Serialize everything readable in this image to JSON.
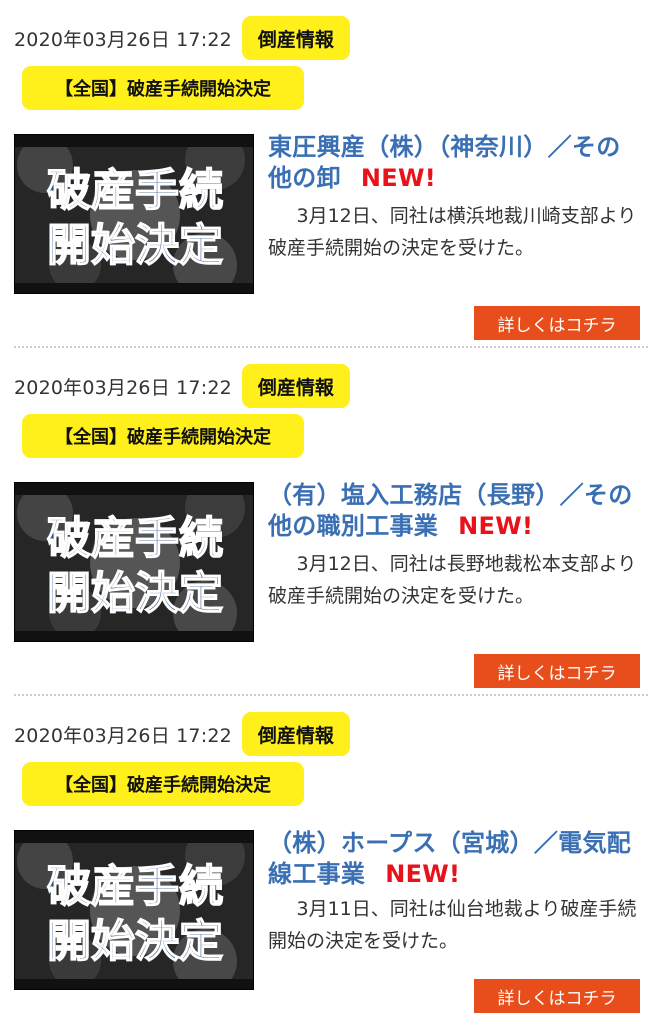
{
  "articles": [
    {
      "date": "2020年03月26日  17:22",
      "category": "倒産情報",
      "region_tag": "【全国】破産手続開始決定",
      "thumbnail_text": [
        "破産手続",
        "開始決定"
      ],
      "title": "東圧興産（株）（神奈川）／その他の卸",
      "new_label": "NEW!",
      "summary": "3月12日、同社は横浜地裁川崎支部より破産手続開始の決定を受けた。",
      "more_label": "詳しくはコチラ"
    },
    {
      "date": "2020年03月26日  17:22",
      "category": "倒産情報",
      "region_tag": "【全国】破産手続開始決定",
      "thumbnail_text": [
        "破産手続",
        "開始決定"
      ],
      "title": "（有）塩入工務店（長野）／その他の職別工事業",
      "new_label": "NEW!",
      "summary": "3月12日、同社は長野地裁松本支部より破産手続開始の決定を受けた。",
      "more_label": "詳しくはコチラ"
    },
    {
      "date": "2020年03月26日  17:22",
      "category": "倒産情報",
      "region_tag": "【全国】破産手続開始決定",
      "thumbnail_text": [
        "破産手続",
        "開始決定"
      ],
      "title": "（株）ホープス（宮城）／電気配線工事業",
      "new_label": "NEW!",
      "summary": "3月11日、同社は仙台地裁より破産手続開始の決定を受けた。",
      "more_label": "詳しくはコチラ"
    }
  ],
  "colors": {
    "badge_yellow": "#ffef1a",
    "title_blue": "#3a6fb3",
    "new_red": "#e8121b",
    "button_orange": "#e84e1c",
    "thumbnail_text_blue": "#2a4f86"
  }
}
